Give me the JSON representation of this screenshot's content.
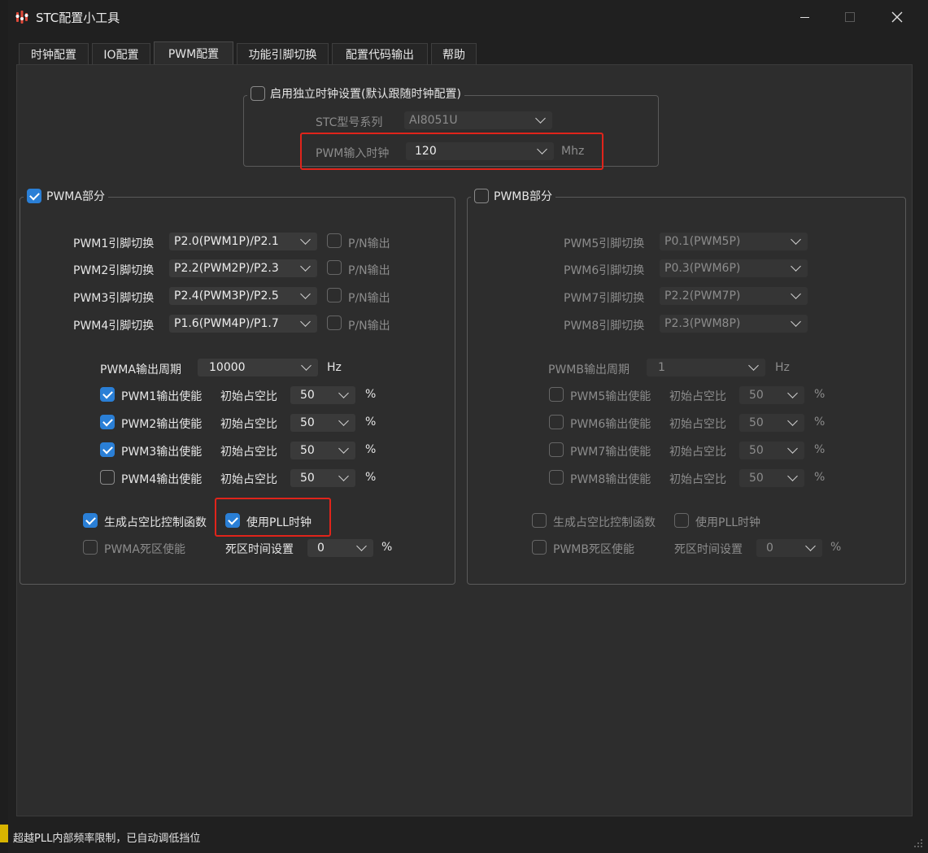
{
  "window": {
    "title": "STC配置小工具",
    "minimize_icon": "minimize-icon",
    "maximize_icon": "maximize-icon",
    "close_icon": "close-icon"
  },
  "tabs": [
    {
      "label": "时钟配置"
    },
    {
      "label": "IO配置"
    },
    {
      "label": "PWM配置"
    },
    {
      "label": "功能引脚切换"
    },
    {
      "label": "配置代码输出"
    },
    {
      "label": "帮助"
    }
  ],
  "clock": {
    "independent_label": "启用独立时钟设置(默认跟随时钟配置)",
    "independent_checked": false,
    "model_label": "STC型号系列",
    "model_value": "AI8051U",
    "input_clock_label": "PWM输入时钟",
    "input_clock_value": "120",
    "input_clock_unit": "Mhz"
  },
  "pwma": {
    "title": "PWMA部分",
    "enabled": true,
    "pins": [
      {
        "label": "PWM1引脚切换",
        "value": "P2.0(PWM1P)/P2.1",
        "pn_label": "P/N输出"
      },
      {
        "label": "PWM2引脚切换",
        "value": "P2.2(PWM2P)/P2.3",
        "pn_label": "P/N输出"
      },
      {
        "label": "PWM3引脚切换",
        "value": "P2.4(PWM3P)/P2.5",
        "pn_label": "P/N输出"
      },
      {
        "label": "PWM4引脚切换",
        "value": "P1.6(PWM4P)/P1.7",
        "pn_label": "P/N输出"
      }
    ],
    "period_label": "PWMA输出周期",
    "period_value": "10000",
    "period_unit": "Hz",
    "outputs": [
      {
        "label": "PWM1输出使能",
        "checked": true,
        "duty_label": "初始占空比",
        "duty": "50",
        "unit": "%"
      },
      {
        "label": "PWM2输出使能",
        "checked": true,
        "duty_label": "初始占空比",
        "duty": "50",
        "unit": "%"
      },
      {
        "label": "PWM3输出使能",
        "checked": true,
        "duty_label": "初始占空比",
        "duty": "50",
        "unit": "%"
      },
      {
        "label": "PWM4输出使能",
        "checked": false,
        "duty_label": "初始占空比",
        "duty": "50",
        "unit": "%"
      }
    ],
    "gen_duty_func_label": "生成占空比控制函数",
    "gen_duty_func_checked": true,
    "use_pll_label": "使用PLL时钟",
    "use_pll_checked": true,
    "deadzone_label": "PWMA死区使能",
    "deadtime_label": "死区时间设置",
    "deadtime_value": "0",
    "deadtime_unit": "%"
  },
  "pwmb": {
    "title": "PWMB部分",
    "enabled": false,
    "pins": [
      {
        "label": "PWM5引脚切换",
        "value": "P0.1(PWM5P)"
      },
      {
        "label": "PWM6引脚切换",
        "value": "P0.3(PWM6P)"
      },
      {
        "label": "PWM7引脚切换",
        "value": "P2.2(PWM7P)"
      },
      {
        "label": "PWM8引脚切换",
        "value": "P2.3(PWM8P)"
      }
    ],
    "period_label": "PWMB输出周期",
    "period_value": "1",
    "period_unit": "Hz",
    "outputs": [
      {
        "label": "PWM5输出使能",
        "duty_label": "初始占空比",
        "duty": "50",
        "unit": "%"
      },
      {
        "label": "PWM6输出使能",
        "duty_label": "初始占空比",
        "duty": "50",
        "unit": "%"
      },
      {
        "label": "PWM7输出使能",
        "duty_label": "初始占空比",
        "duty": "50",
        "unit": "%"
      },
      {
        "label": "PWM8输出使能",
        "duty_label": "初始占空比",
        "duty": "50",
        "unit": "%"
      }
    ],
    "gen_duty_func_label": "生成占空比控制函数",
    "use_pll_label": "使用PLL时钟",
    "deadzone_label": "PWMB死区使能",
    "deadtime_label": "死区时间设置",
    "deadtime_value": "0",
    "deadtime_unit": "%"
  },
  "status": {
    "message": "超越PLL内部频率限制，已自动调低挡位"
  },
  "colors": {
    "accent": "#2a7fd6",
    "highlight": "#e0241b",
    "background": "#2d2d2d"
  }
}
